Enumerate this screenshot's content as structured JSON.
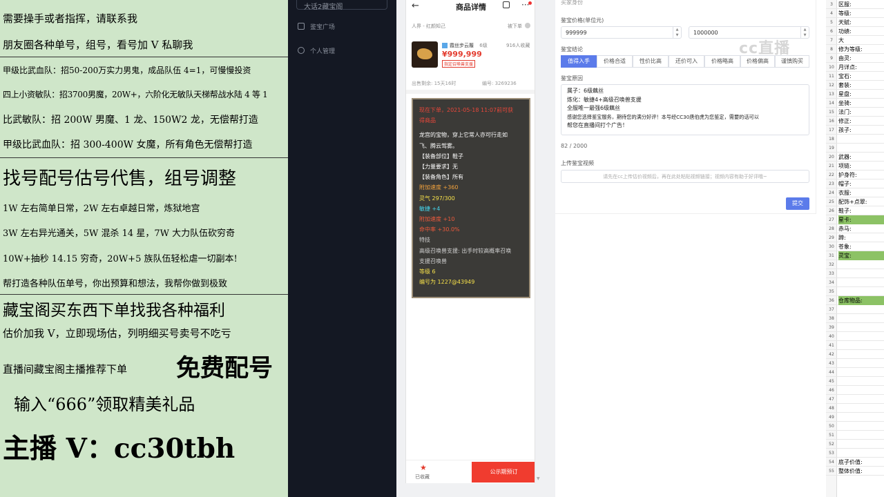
{
  "promo": {
    "lines": [
      "需要操手或者指挥，请联系我",
      "朋友圈各种单号，组号，看号加 V 私聊我",
      "甲级比武血队：招50-200万实力男鬼，成品队伍 4=1，可慢慢投资",
      "四上小资敏队：招3700男魔，20W+，六阶化无敏队天梯帮战水陆 4 等 1",
      "比武敏队：招 200W 男魔、1 龙、150W2 龙，无偿帮打造",
      "甲级比武血队：招 300-400W 女魔，所有角色无偿帮打造",
      "找号配号估号代售，组号调整",
      "1W 左右简单日常，2W 左右卓越日常，炼狱地宫",
      "3W 左右异光通关，5W 混杀 14 星，7W 大力队伍砍穷奇",
      "10W+抽秒 14.15 穷奇，20W+5 族队伍轻松虐一切副本!",
      "帮打造各种队伍单号，你出预算和想法，我帮你做到极致",
      "藏宝阁买东西下单找我各种福利",
      "估价加我 V，立即现场估，列明细买号卖号不吃亏",
      "直播间藏宝阁主播推荐下单",
      "免费配号",
      "输入“666”领取精美礼品",
      "主播 V：cc30tbh"
    ]
  },
  "nav": {
    "top_select": "大话2藏宝阁",
    "items": [
      "鉴宝广场",
      "个人管理"
    ]
  },
  "phone": {
    "title": "商品详情",
    "server": "人界 - 红颜知己",
    "offline": "被下单",
    "item_name": "霞丝步云履",
    "item_level": "6级",
    "price": "¥999,999",
    "badge": "指定召唤兽支援",
    "favorites": "916人收藏",
    "remaining": "出售剩余: 15天16时",
    "id_label": "编号: 3269236",
    "card_lines": [
      {
        "text": "现在下单，2021-05-18 11:07前可获",
        "color": "#e8473a"
      },
      {
        "text": "得商品",
        "color": "#e8473a"
      },
      {
        "text": "",
        "color": "#ffffff"
      },
      {
        "text": "龙宫的宝物，穿上它常人亦可行走如",
        "color": "#ffffff"
      },
      {
        "text": "飞、腾云驾雾。",
        "color": "#ffffff"
      },
      {
        "text": "【装备部位】鞋子",
        "color": "#ffffff"
      },
      {
        "text": "【力量要求】无",
        "color": "#ffffff"
      },
      {
        "text": "【装备角色】所有",
        "color": "#ffffff"
      },
      {
        "text": "附加速度 +360",
        "color": "#f2a23c"
      },
      {
        "text": "灵气 297/300",
        "color": "#f7e14a"
      },
      {
        "text": "敏捷 +4",
        "color": "#45d8f0"
      },
      {
        "text": "附加速度 +10",
        "color": "#ee5a3c"
      },
      {
        "text": "命中率 +30.0%",
        "color": "#ee5a3c"
      },
      {
        "text": "特技",
        "color": "#cfcfcf"
      },
      {
        "text": "高级召唤兽支援: 出手时较高概率召唤",
        "color": "#cfcfcf"
      },
      {
        "text": "支援召唤兽",
        "color": "#cfcfcf"
      },
      {
        "text": "等级 6",
        "color": "#f7e14a"
      },
      {
        "text": "编号为 1227@43949",
        "color": "#f7e14a"
      }
    ],
    "fav_label": "已收藏",
    "cta": "公示期预订"
  },
  "form": {
    "section_top": "买家身份",
    "price_label": "鉴宝价格(单位元)",
    "price_min": "999999",
    "price_max": "1000000",
    "conclusion_label": "鉴宝结论",
    "chips": [
      "值得入手",
      "价格合适",
      "性价比高",
      "还价可入",
      "价格略高",
      "价格偏高",
      "谨慎购买"
    ],
    "reason_label": "鉴宝原因",
    "reason_lines": [
      "属子：6级藕丝",
      "炼化：敏捷4+高级召唤兽支援",
      "全服唯一最强6级藕丝",
      "感谢您选择鉴宝服务，期待您的满分好评！本号经CC30唐伯虎为您鉴定，需要的话可以",
      "帮您在直播间打个广告！"
    ],
    "count": "82 / 2000",
    "video_label": "上传鉴宝视频",
    "video_placeholder": "请先在cc上传估价视频后，再在此处粘贴视频链接；视频内容有助于好评哦~",
    "submit": "提交",
    "watermark": "cc直播"
  },
  "sheet": {
    "rows": [
      {
        "n": "3",
        "t": "区服:"
      },
      {
        "n": "4",
        "t": "等级:"
      },
      {
        "n": "5",
        "t": "天赋:"
      },
      {
        "n": "6",
        "t": "功绩:"
      },
      {
        "n": "7",
        "t": "大"
      },
      {
        "n": "8",
        "t": "修为等级:"
      },
      {
        "n": "9",
        "t": "由灵:"
      },
      {
        "n": "10",
        "t": "月详点:"
      },
      {
        "n": "11",
        "t": "宝石:"
      },
      {
        "n": "12",
        "t": "套装:"
      },
      {
        "n": "13",
        "t": "星盘:"
      },
      {
        "n": "14",
        "t": "坐骑:"
      },
      {
        "n": "15",
        "t": "法门:"
      },
      {
        "n": "16",
        "t": "修正:"
      },
      {
        "n": "17",
        "t": "孩子:"
      },
      {
        "n": "18",
        "t": ""
      },
      {
        "n": "19",
        "t": ""
      },
      {
        "n": "20",
        "t": "武器:"
      },
      {
        "n": "21",
        "t": "项链:"
      },
      {
        "n": "22",
        "t": "护身符:"
      },
      {
        "n": "23",
        "t": "帽子:"
      },
      {
        "n": "24",
        "t": "衣服:"
      },
      {
        "n": "25",
        "t": "配饰+点翠:"
      },
      {
        "n": "26",
        "t": "鞋子:"
      },
      {
        "n": "27",
        "t": "星卡:",
        "green": true
      },
      {
        "n": "28",
        "t": "赤马:"
      },
      {
        "n": "29",
        "t": "蹄:"
      },
      {
        "n": "30",
        "t": "苍象:"
      },
      {
        "n": "31",
        "t": "灵宝:",
        "green": true
      },
      {
        "n": "32",
        "t": ""
      },
      {
        "n": "33",
        "t": ""
      },
      {
        "n": "34",
        "t": ""
      },
      {
        "n": "35",
        "t": ""
      },
      {
        "n": "36",
        "t": "仓库物品:",
        "green": true
      },
      {
        "n": "37",
        "t": ""
      },
      {
        "n": "38",
        "t": ""
      },
      {
        "n": "39",
        "t": ""
      },
      {
        "n": "40",
        "t": ""
      },
      {
        "n": "41",
        "t": ""
      },
      {
        "n": "42",
        "t": ""
      },
      {
        "n": "43",
        "t": ""
      },
      {
        "n": "44",
        "t": ""
      },
      {
        "n": "45",
        "t": ""
      },
      {
        "n": "46",
        "t": ""
      },
      {
        "n": "47",
        "t": ""
      },
      {
        "n": "48",
        "t": ""
      },
      {
        "n": "49",
        "t": ""
      },
      {
        "n": "50",
        "t": ""
      },
      {
        "n": "51",
        "t": ""
      },
      {
        "n": "52",
        "t": ""
      },
      {
        "n": "53",
        "t": ""
      },
      {
        "n": "54",
        "t": "底子价值:"
      },
      {
        "n": "55",
        "t": "整体价值:"
      }
    ]
  }
}
